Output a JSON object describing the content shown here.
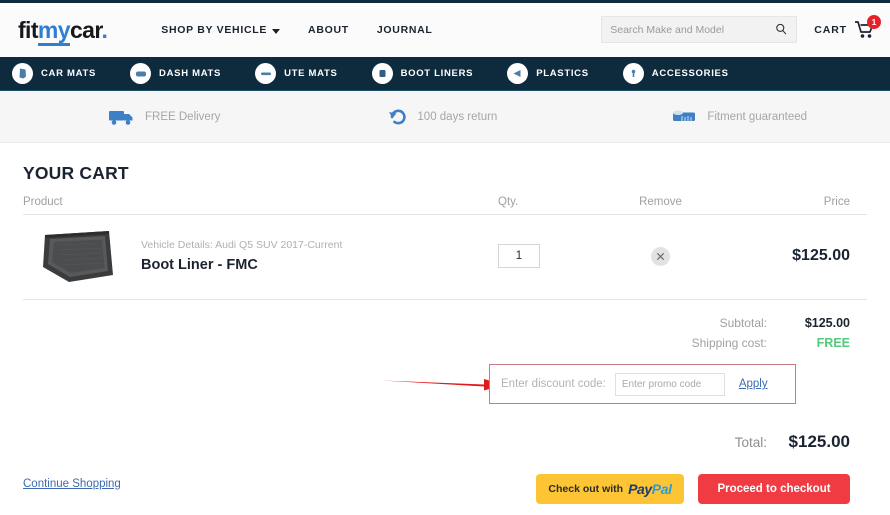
{
  "header": {
    "logo": {
      "fit": "fit",
      "my": "my",
      "car": "car",
      "dot": "."
    },
    "nav": [
      {
        "label": "SHOP BY VEHICLE",
        "has_chevron": true,
        "icon": "chevron-down-icon"
      },
      {
        "label": "ABOUT",
        "has_chevron": false
      },
      {
        "label": "JOURNAL",
        "has_chevron": false
      }
    ],
    "search": {
      "placeholder": "Search Make and Model",
      "value": "",
      "icon": "search-icon"
    },
    "cart": {
      "label": "CART",
      "badge": "1",
      "icon": "cart-icon"
    }
  },
  "category_nav": [
    {
      "label": "CAR MATS",
      "icon": "car-mat-icon"
    },
    {
      "label": "DASH MATS",
      "icon": "dash-mat-icon"
    },
    {
      "label": "UTE MATS",
      "icon": "ute-mat-icon"
    },
    {
      "label": "BOOT LINERS",
      "icon": "boot-liner-icon"
    },
    {
      "label": "PLASTICS",
      "icon": "plastics-icon"
    },
    {
      "label": "ACCESSORIES",
      "icon": "accessories-icon"
    }
  ],
  "benefits": [
    {
      "label": "FREE Delivery",
      "icon": "truck-icon"
    },
    {
      "label": "100 days return",
      "icon": "return-arrow-icon"
    },
    {
      "label": "Fitment guaranteed",
      "icon": "measuring-tape-icon"
    }
  ],
  "cart": {
    "title": "YOUR CART",
    "columns": {
      "product": "Product",
      "qty": "Qty.",
      "remove": "Remove",
      "price": "Price"
    },
    "items": [
      {
        "vehicle_details": "Vehicle Details: Audi Q5 SUV 2017-Current",
        "name": "Boot Liner - FMC",
        "qty": "1",
        "remove_icon": "close-icon",
        "price": "$125.00",
        "image": "boot-liner-product-image"
      }
    ],
    "subtotal_label": "Subtotal:",
    "subtotal_value": "$125.00",
    "shipping_label": "Shipping cost:",
    "shipping_value": "FREE",
    "discount": {
      "label": "Enter discount code:",
      "placeholder": "Enter promo code",
      "value": "",
      "apply_label": "Apply"
    },
    "total_label": "Total:",
    "total_value": "$125.00"
  },
  "footer": {
    "continue_shopping": "Continue Shopping",
    "paypal": {
      "prefix": "Check out with",
      "pay": "Pay",
      "pal": "Pal"
    },
    "checkout": "Proceed to checkout"
  },
  "colors": {
    "nav_bg": "#0e2a3d",
    "accent_blue": "#2f7fd0",
    "badge_red": "#e8202a",
    "free_green": "#52c97f",
    "checkout_red": "#ef3b41",
    "paypal_yellow": "#fdc534",
    "highlight_border": "#c97c80",
    "annotation_arrow": "#e01b1b"
  }
}
